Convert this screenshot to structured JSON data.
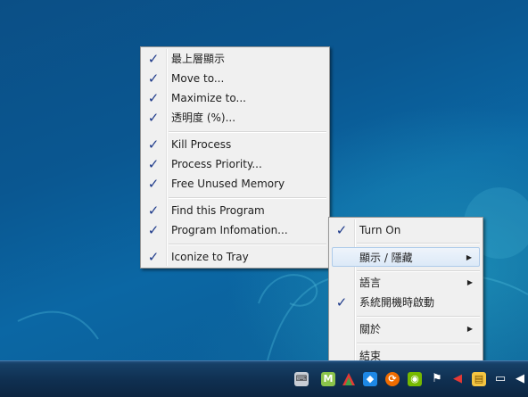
{
  "context_menu": {
    "items": [
      {
        "label": "最上層顯示",
        "checked": true
      },
      {
        "label": "Move to...",
        "checked": true
      },
      {
        "label": "Maximize to...",
        "checked": true
      },
      {
        "label": "透明度 (%)...",
        "checked": true
      },
      {
        "label": "Kill Process",
        "checked": true
      },
      {
        "label": "Process Priority...",
        "checked": true
      },
      {
        "label": "Free Unused Memory",
        "checked": true
      },
      {
        "label": "Find this Program",
        "checked": true
      },
      {
        "label": "Program Infomation...",
        "checked": true
      },
      {
        "label": "Iconize to Tray",
        "checked": true
      }
    ]
  },
  "tray_menu": {
    "items": [
      {
        "label": "Turn On",
        "checked": true
      },
      {
        "label": "顯示 / 隱藏",
        "checked": false,
        "submenu": true,
        "highlighted": true
      },
      {
        "label": "語言",
        "checked": false,
        "submenu": true
      },
      {
        "label": "系統開機時啟動",
        "checked": true
      },
      {
        "label": "關於",
        "checked": false,
        "submenu": true
      },
      {
        "label": "結束",
        "checked": false
      }
    ]
  },
  "glyphs": {
    "check": "✓",
    "submenu_arrow": "▶"
  },
  "taskbar": {
    "tray_icons": [
      "keyboard-icon",
      "gmail-notifier-icon",
      "app-launcher-icon",
      "dropbox-icon",
      "sync-icon",
      "nvidia-icon",
      "flag-icon",
      "volume-muted-icon",
      "folder-icon",
      "network-icon",
      "volume-icon"
    ]
  },
  "colors": {
    "menu_bg": "#f0f0f0",
    "check": "#1e3a8a",
    "highlight": "#dce9f7"
  }
}
